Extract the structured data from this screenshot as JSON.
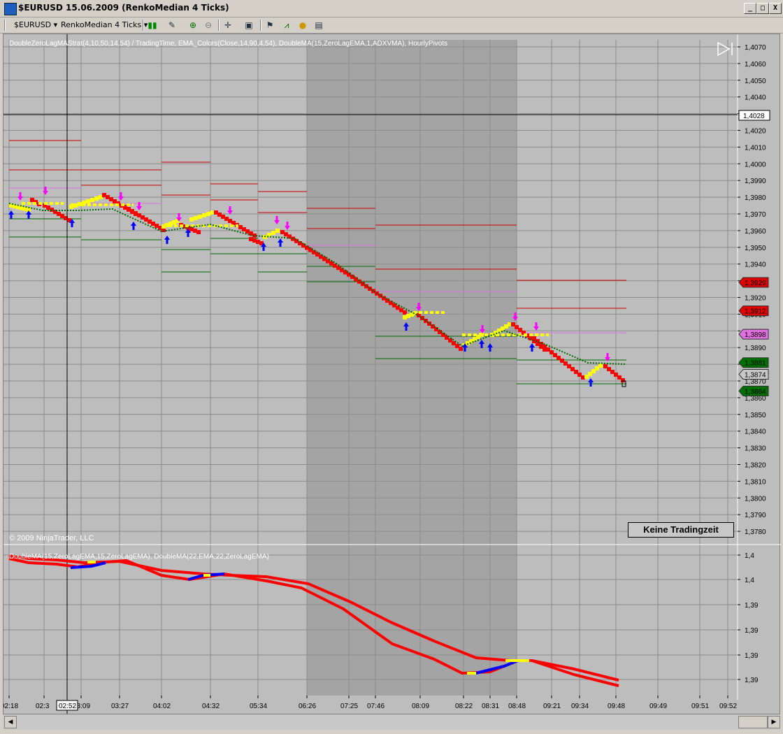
{
  "window": {
    "title": "$EURUSD  15.06.2009 (RenkoMedian 4 Ticks)",
    "min_label": "_",
    "max_label": "□",
    "close_label": "X"
  },
  "toolbar": {
    "instrument": "$EURUSD",
    "period": "RenkoMedian 4 Ticks",
    "icons": [
      "bar-style-icon",
      "draw-tool-icon",
      "zoom-in-icon",
      "zoom-out-icon",
      "crosshair-icon",
      "properties-icon",
      "strategies-icon",
      "indicators-icon",
      "chart-trader-icon",
      "data-box-icon"
    ]
  },
  "panel1": {
    "indicator_label": "DoubleZeroLagMAStrat(4,10,50,14,54) / TradingTime, EMA_Colors(Close,14,90,4,54), DoubleMA(15,ZeroLagEMA,1,ADXVMA), HourlyPivots",
    "copyright": "© 2009 NinjaTrader, LLC",
    "no_trading_label": "Keine Tradingzeit",
    "price_ticks": [
      "1,4070",
      "1,4060",
      "1,4050",
      "1,4040",
      "1,4030",
      "1,4020",
      "1,4010",
      "1,4000",
      "1,3990",
      "1,3980",
      "1,3970",
      "1,3960",
      "1,3950",
      "1,3940",
      "1,3930",
      "1,3920",
      "1,3910",
      "1,3900",
      "1,3890",
      "1,3880",
      "1,3870",
      "1,3860",
      "1,3850",
      "1,3840",
      "1,3830",
      "1,3820",
      "1,3810",
      "1,3800",
      "1,3790",
      "1,3780"
    ],
    "crosshair_price": "1,4028",
    "price_markers": [
      {
        "value": "1,3929",
        "color": "#e00000"
      },
      {
        "value": "1,3912",
        "color": "#e00000"
      },
      {
        "value": "1,3898",
        "color": "#e070e0"
      },
      {
        "value": "1,3881",
        "color": "#007000"
      },
      {
        "value": "1,3874",
        "color": "#c8c8c8"
      },
      {
        "value": "1,3864",
        "color": "#007000"
      }
    ]
  },
  "panel2": {
    "indicator_label": "DoubleMA(15,ZeroLagEMA,15,ZeroLagEMA), DoubleMA(22,EMA,22,ZeroLagEMA)",
    "price_ticks": [
      "1,4",
      "1,4",
      "1,39",
      "1,39",
      "1,39",
      "1,39"
    ]
  },
  "time_axis": {
    "ticks": [
      "02:18",
      "02:3",
      "03:09",
      "03:27",
      "04:02",
      "04:32",
      "05:34",
      "06:26",
      "07:25",
      "07:46",
      "08:09",
      "08:22",
      "08:31",
      "08:48",
      "09:21",
      "09:34",
      "09:48",
      "09:49",
      "09:51",
      "09:52"
    ],
    "crosshair_time": "02:52"
  },
  "colors": {
    "chart_bg": "#bdbdbd",
    "no_trading_bg": "#a4a4a4",
    "down_brick": "#ff0000",
    "up_brick": "#ffff00",
    "buy_arrow": "#0000ff",
    "sell_arrow": "#ff00ff",
    "resistance": "#cc0000",
    "support": "#006600"
  }
}
